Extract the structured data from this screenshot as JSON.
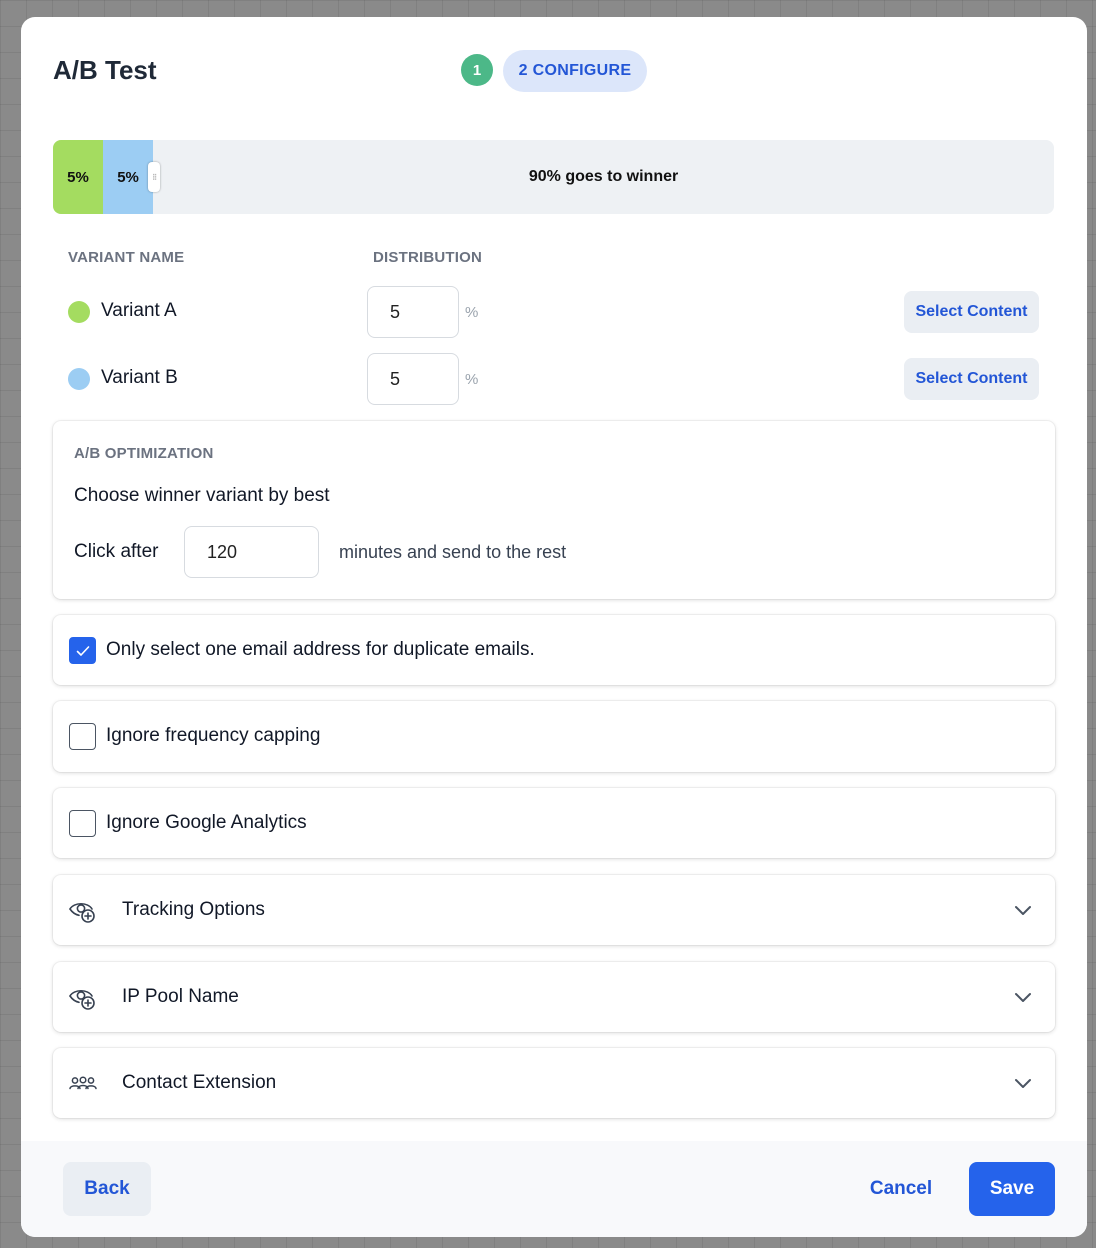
{
  "header": {
    "title": "A/B Test",
    "steps": [
      {
        "label": "1",
        "state": "done",
        "color": "#4cb888"
      },
      {
        "label": "2 CONFIGURE",
        "state": "active"
      }
    ]
  },
  "distribution_bar": {
    "segments": [
      {
        "label": "5%",
        "percent": 5,
        "color": "#a4dc60"
      },
      {
        "label": "5%",
        "percent": 5,
        "color": "#9ccdf3"
      }
    ],
    "winner_label": "90% goes to winner",
    "winner_percent": 90,
    "handle_icon": "drag-handle-icon"
  },
  "variants": {
    "headers": {
      "name": "VARIANT NAME",
      "distribution": "DISTRIBUTION"
    },
    "percent_sign": "%",
    "rows": [
      {
        "name": "Variant A",
        "color": "#a4dc60",
        "distribution": "5",
        "select_label": "Select Content"
      },
      {
        "name": "Variant B",
        "color": "#9ccdf3",
        "distribution": "5",
        "select_label": "Select Content"
      }
    ]
  },
  "optimization": {
    "title": "A/B OPTIMIZATION",
    "choose_label": "Choose winner variant by best",
    "click_label": "Click after",
    "minutes_value": "120",
    "minutes_label": "minutes and send to the rest"
  },
  "options": [
    {
      "label": "Only select one email address for duplicate emails.",
      "checked": true
    },
    {
      "label": "Ignore frequency capping",
      "checked": false
    },
    {
      "label": "Ignore Google Analytics",
      "checked": false
    }
  ],
  "accordions": [
    {
      "label": "Tracking Options",
      "icon": "eye-plus-icon",
      "expanded": false
    },
    {
      "label": "IP Pool Name",
      "icon": "eye-plus-icon",
      "expanded": false
    },
    {
      "label": "Contact Extension",
      "icon": "users-icon",
      "expanded": false
    }
  ],
  "footer": {
    "back_label": "Back",
    "cancel_label": "Cancel",
    "save_label": "Save"
  },
  "colors": {
    "primary": "#2563eb",
    "link": "#2356d6",
    "success": "#4cb888"
  }
}
